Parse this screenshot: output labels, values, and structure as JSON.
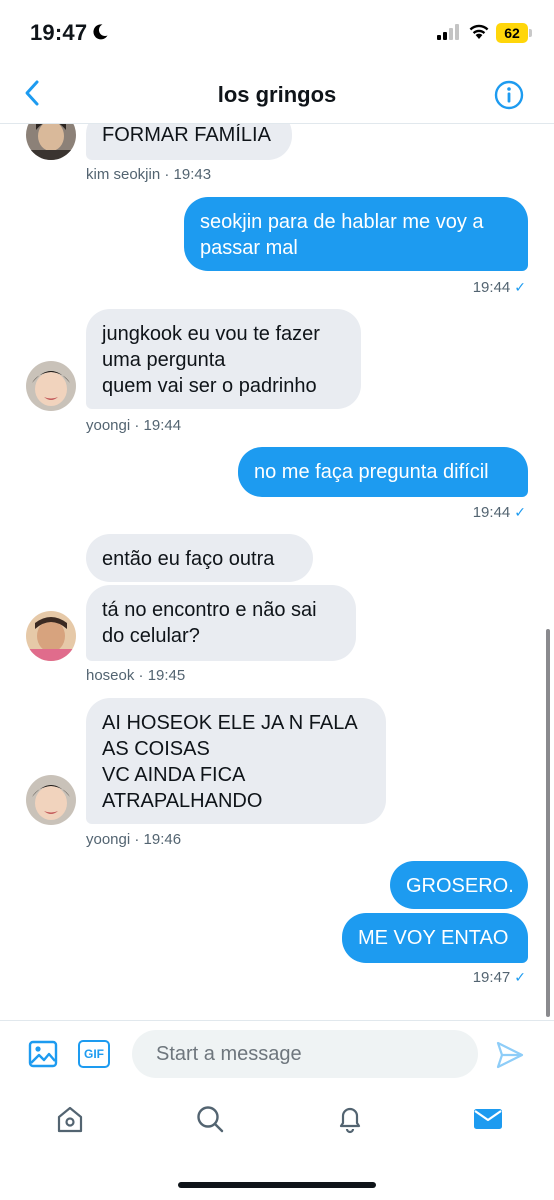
{
  "status_bar": {
    "time": "19:47",
    "battery": "62"
  },
  "header": {
    "title": "los gringos"
  },
  "messages": [
    {
      "text": "FORMAR FAMÍLIA"
    },
    {
      "meta": "kim seokjin · 19:43"
    },
    {
      "text": "seokjin para de hablar me voy a\npassar mal"
    },
    {
      "meta": "19:44"
    },
    {
      "text": "jungkook eu vou te fazer\numa pergunta\nquem vai ser o padrinho"
    },
    {
      "meta": "yoongi · 19:44"
    },
    {
      "text": "no me faça pregunta difícil"
    },
    {
      "meta": "19:44"
    },
    {
      "text": "então eu faço outra"
    },
    {
      "text": "tá no encontro e não sai\ndo celular?"
    },
    {
      "meta": "hoseok · 19:45"
    },
    {
      "text": "AI HOSEOK ELE JA N FALA\nAS COISAS\nVC AINDA FICA\nATRAPALHANDO"
    },
    {
      "meta": "yoongi · 19:46"
    },
    {
      "text": "GROSERO."
    },
    {
      "text": "ME VOY ENTAO"
    },
    {
      "meta": "19:47"
    }
  ],
  "check_mark": "✓",
  "composer": {
    "placeholder": "Start a message",
    "gif_label": "GIF"
  },
  "colors": {
    "accent": "#1d9bf0",
    "incoming_bubble": "#e9ecf1",
    "outgoing_bubble": "#1d9bf0",
    "battery": "#ffd60a"
  },
  "icons": {
    "back": "chevron-left-icon",
    "info": "info-icon",
    "image": "image-icon",
    "gif": "gif-icon",
    "send": "send-icon",
    "tabs": [
      "home-icon",
      "search-icon",
      "bell-icon",
      "mail-icon"
    ]
  }
}
